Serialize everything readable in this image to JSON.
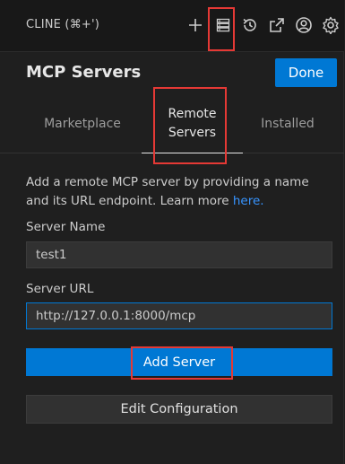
{
  "titlebar": {
    "title": "CLINE (⌘+')",
    "icons": [
      "plus-icon",
      "mcp-servers-icon",
      "history-icon",
      "popout-icon",
      "account-icon",
      "settings-icon"
    ]
  },
  "header": {
    "title": "MCP Servers",
    "done_label": "Done"
  },
  "tabs": [
    {
      "label": "Marketplace",
      "active": false
    },
    {
      "label": "Remote Servers",
      "active": true
    },
    {
      "label": "Installed",
      "active": false
    }
  ],
  "remote": {
    "description": "Add a remote MCP server by providing a name and its URL endpoint. Learn more",
    "link_text": "here.",
    "server_name_label": "Server Name",
    "server_name_value": "test1",
    "server_url_label": "Server URL",
    "server_url_value": "http://127.0.0.1:8000/mcp",
    "add_button": "Add Server",
    "edit_button": "Edit Configuration"
  },
  "colors": {
    "accent": "#0078d4",
    "link": "#3794ff",
    "highlight": "#e53935",
    "background": "#1f1f1f"
  }
}
